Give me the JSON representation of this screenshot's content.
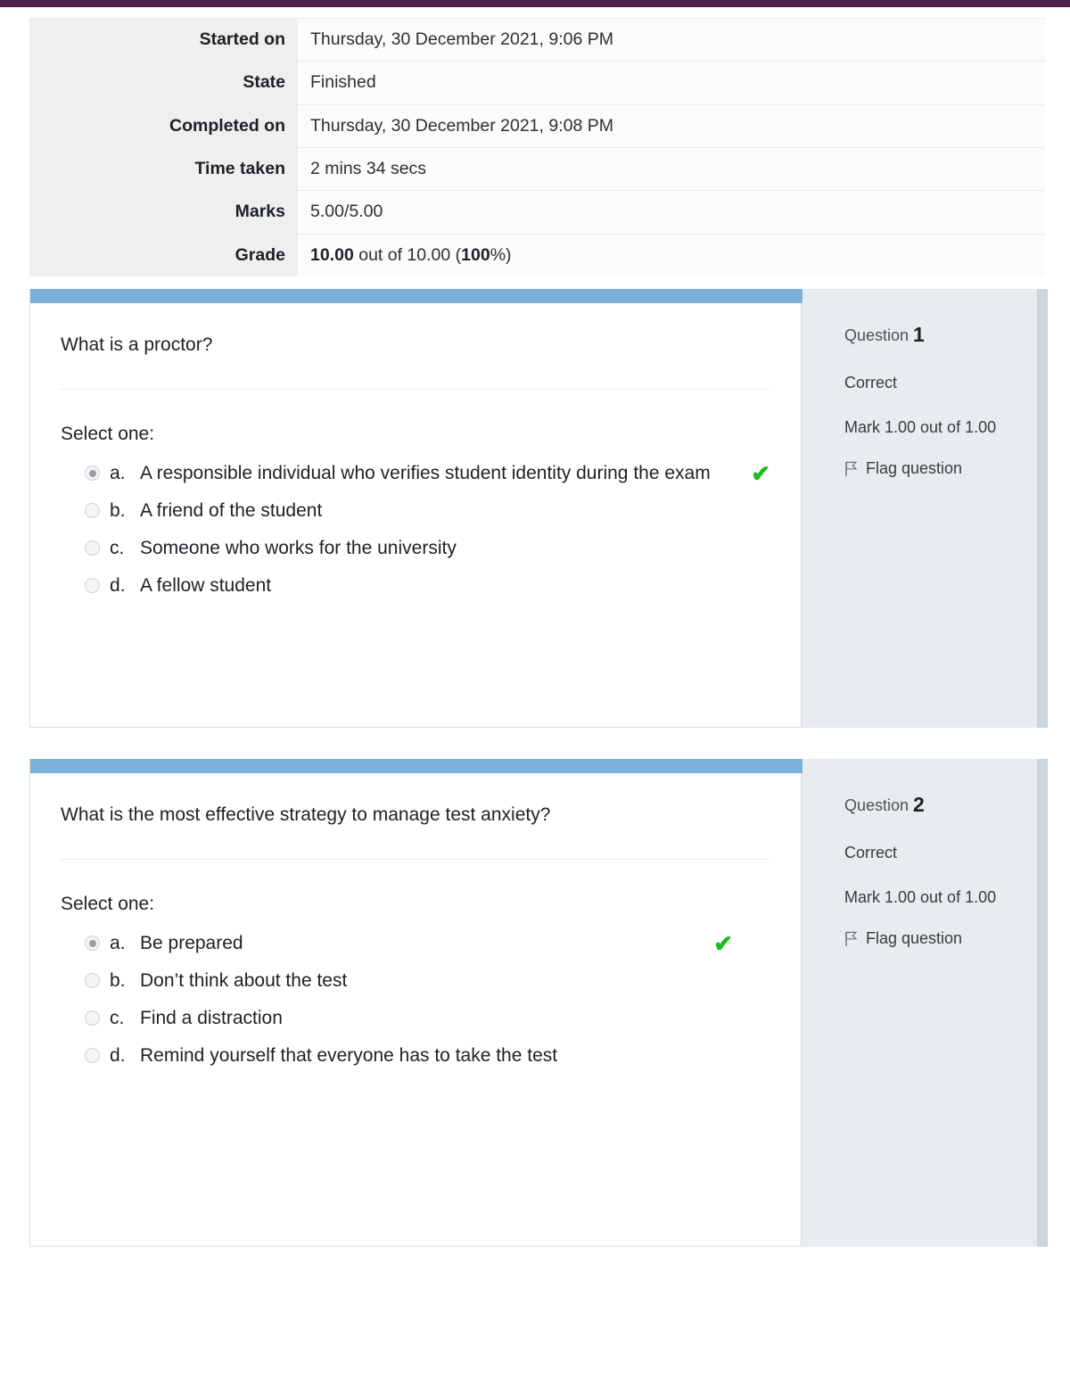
{
  "theme": {
    "top_bar_color": "#4a2545",
    "question_header_color": "#7cb0dc",
    "info_panel_color": "#e9ecef",
    "info_panel_edge_color": "#ced4da",
    "correct_tick_color": "#1fbb1f"
  },
  "summary": {
    "rows": [
      {
        "label": "Started on",
        "value": "Thursday, 30 December 2021, 9:06 PM"
      },
      {
        "label": "State",
        "value": "Finished"
      },
      {
        "label": "Completed on",
        "value": "Thursday, 30 December 2021, 9:08 PM"
      },
      {
        "label": "Time taken",
        "value": "2 mins 34 secs"
      },
      {
        "label": "Marks",
        "value": "5.00/5.00"
      }
    ],
    "grade_row": {
      "label": "Grade",
      "value_bold_1": "10.00",
      "value_mid": " out of 10.00 (",
      "value_bold_2": "100",
      "value_end": "%)"
    }
  },
  "questions": [
    {
      "text": "What is a proctor?",
      "select_one_label": "Select one:",
      "answers": [
        {
          "letter": "a.",
          "text": "A responsible individual who verifies student identity during the exam",
          "selected": true,
          "correct_tick": true,
          "tick_inline": true
        },
        {
          "letter": "b.",
          "text": "A friend of the student",
          "selected": false,
          "correct_tick": false,
          "tick_inline": false
        },
        {
          "letter": "c.",
          "text": "Someone who works for the university",
          "selected": false,
          "correct_tick": false,
          "tick_inline": false
        },
        {
          "letter": "d.",
          "text": "A fellow student",
          "selected": false,
          "correct_tick": false,
          "tick_inline": false
        }
      ],
      "info": {
        "question_word": "Question ",
        "number": "1",
        "state": "Correct",
        "mark": "Mark 1.00 out of 1.00",
        "flag_label": "Flag question"
      }
    },
    {
      "text": "What is the most effective strategy to manage test anxiety?",
      "select_one_label": "Select one:",
      "answers": [
        {
          "letter": "a.",
          "text": "Be prepared",
          "selected": true,
          "correct_tick": true,
          "tick_inline": false
        },
        {
          "letter": "b.",
          "text": "Don’t think about the test",
          "selected": false,
          "correct_tick": false,
          "tick_inline": false
        },
        {
          "letter": "c.",
          "text": "Find a distraction",
          "selected": false,
          "correct_tick": false,
          "tick_inline": false
        },
        {
          "letter": "d.",
          "text": "Remind yourself that everyone has to take the test",
          "selected": false,
          "correct_tick": false,
          "tick_inline": false
        }
      ],
      "info": {
        "question_word": "Question ",
        "number": "2",
        "state": "Correct",
        "mark": "Mark 1.00 out of 1.00",
        "flag_label": "Flag question"
      }
    }
  ],
  "icons": {
    "flag": "flag-icon",
    "tick": "check-icon",
    "radio": "radio-button-icon"
  }
}
